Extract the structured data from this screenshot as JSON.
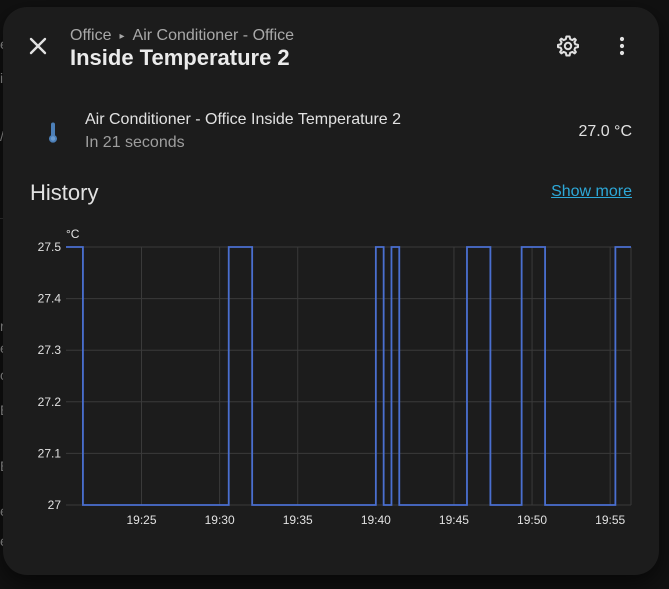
{
  "background": {
    "fragments": [
      "e",
      "i",
      "/",
      "r",
      "e",
      "c",
      "E",
      "E",
      "e",
      "e"
    ]
  },
  "dialog": {
    "breadcrumb": [
      "Office",
      "Air Conditioner - Office"
    ],
    "title": "Inside Temperature 2",
    "close_icon": "close-icon",
    "settings_icon": "gear-icon",
    "menu_icon": "dots-vertical-icon"
  },
  "entity": {
    "icon": "thermometer-icon",
    "name": "Air Conditioner - Office Inside Temperature 2",
    "secondary": "In 21 seconds",
    "state": "27.0 °C"
  },
  "history": {
    "title": "History",
    "show_more": "Show more"
  },
  "colors": {
    "line": "#4a6fd0",
    "icon": "#4c7fb8",
    "link": "#2da8d8",
    "dialog_bg": "#1c1c1c"
  },
  "chart_data": {
    "type": "line",
    "step": true,
    "ylabel": "°C",
    "y_ticks": [
      "27.5",
      "27.4",
      "27.3",
      "27.2",
      "27.1",
      "27"
    ],
    "ylim": [
      27,
      27.5
    ],
    "x_ticks": [
      "19:25",
      "19:30",
      "19:35",
      "19:40",
      "19:45",
      "19:50",
      "19:55"
    ],
    "xlim": [
      "19:20:10",
      "19:56:20"
    ],
    "grid": true,
    "series": [
      {
        "points": [
          [
            "19:20:10",
            27.5
          ],
          [
            "19:21:15",
            27.0
          ],
          [
            "19:30:35",
            27.5
          ],
          [
            "19:32:05",
            27.0
          ],
          [
            "19:40:00",
            27.5
          ],
          [
            "19:40:30",
            27.0
          ],
          [
            "19:41:00",
            27.5
          ],
          [
            "19:41:30",
            27.0
          ],
          [
            "19:45:50",
            27.5
          ],
          [
            "19:47:20",
            27.0
          ],
          [
            "19:49:20",
            27.5
          ],
          [
            "19:50:50",
            27.0
          ],
          [
            "19:55:20",
            27.5
          ],
          [
            "19:56:20",
            27.5
          ]
        ]
      }
    ]
  }
}
